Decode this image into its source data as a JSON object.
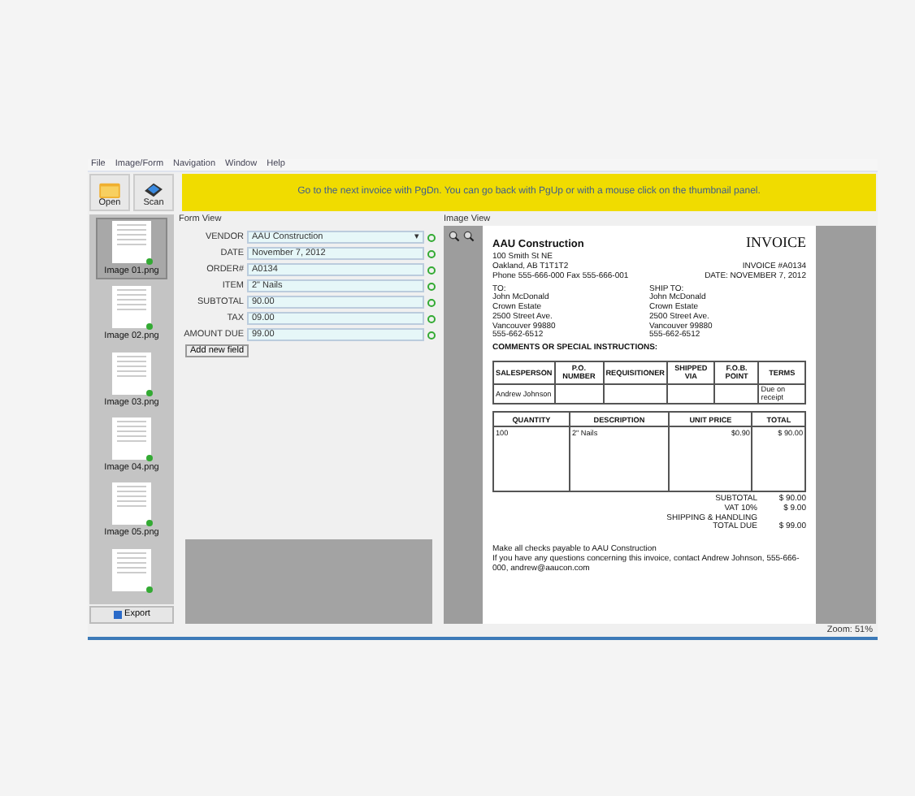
{
  "menu": [
    "File",
    "Image/Form",
    "Navigation",
    "Window",
    "Help"
  ],
  "toolbar": [
    {
      "label": "Open",
      "kind": "folder"
    },
    {
      "label": "Scan",
      "kind": "scanner"
    }
  ],
  "banner": "Go to the next invoice with PgDn. You can go back with PgUp or with a mouse click on the thumbnail panel.",
  "thumbnails": [
    {
      "label": "Image 01.png",
      "selected": true,
      "verified": true
    },
    {
      "label": "Image 02.png",
      "selected": false,
      "verified": true
    },
    {
      "label": "Image 03.png",
      "selected": false,
      "verified": true
    },
    {
      "label": "Image 04.png",
      "selected": false,
      "verified": true
    },
    {
      "label": "Image 05.png",
      "selected": false,
      "verified": true
    },
    {
      "selected": false,
      "verified": true
    }
  ],
  "export_button": "Export",
  "form_view": {
    "title": "Form View",
    "fields": [
      {
        "label": "VENDOR",
        "value": "AAU Construction",
        "kind": "dropdown",
        "caret": "▾"
      },
      {
        "label": "DATE",
        "value": "November 7, 2012",
        "kind": "text"
      },
      {
        "label": "ORDER#",
        "value": "A0134",
        "kind": "text"
      },
      {
        "label": "ITEM",
        "value": "2\" Nails",
        "kind": "text"
      },
      {
        "label": "SUBTOTAL",
        "value": "90.00",
        "kind": "text"
      },
      {
        "label": "TAX",
        "value": "09.00",
        "kind": "text"
      },
      {
        "label": "AMOUNT DUE",
        "value": "99.00",
        "kind": "text"
      }
    ],
    "add_button": "Add new field"
  },
  "image_view": {
    "title": "Image View",
    "invoice": {
      "company": "AAU Construction",
      "heading": "INVOICE",
      "address": [
        "100 Smith St NE",
        "Oakland, AB T1T1T2",
        "Phone 555-666-000  Fax 555-666-001"
      ],
      "meta": [
        "INVOICE #A0134",
        "DATE: NOVEMBER 7, 2012"
      ],
      "to": [
        "TO:",
        "John McDonald",
        "Crown Estate",
        "2500 Street Ave.",
        "Vancouver 99880",
        "555-662-6512"
      ],
      "ship_to": [
        "SHIP TO:",
        "John McDonald",
        "Crown Estate",
        "2500 Street Ave.",
        "Vancouver 99880",
        "555-662-6512"
      ],
      "comments": "COMMENTS OR SPECIAL INSTRUCTIONS:",
      "info_columns": [
        "SALESPERSON",
        "P.O. NUMBER",
        "REQUISITIONER",
        "SHIPPED VIA",
        "F.O.B. POINT",
        "TERMS"
      ],
      "info_row": {
        "salesperson": "Andrew Johnson",
        "terms": "Due on receipt"
      },
      "item_columns": [
        "QUANTITY",
        "DESCRIPTION",
        "UNIT PRICE",
        "TOTAL"
      ],
      "item_rows": [
        [
          "100",
          "2\" Nails",
          "$0.90",
          "$ 90.00"
        ]
      ],
      "totals": [
        {
          "label": "SUBTOTAL",
          "value": "$ 90.00"
        },
        {
          "label": "VAT 10%",
          "value": "$ 9.00"
        },
        {
          "label": "SHIPPING & HANDLING"
        },
        {
          "label": "TOTAL DUE",
          "value": "$ 99.00"
        }
      ],
      "footer": [
        "Make all checks payable to AAU Construction",
        "If you have any questions concerning this invoice, contact Andrew Johnson, 555-666-000, andrew@aaucon.com"
      ]
    }
  },
  "status": "Zoom: 51%"
}
